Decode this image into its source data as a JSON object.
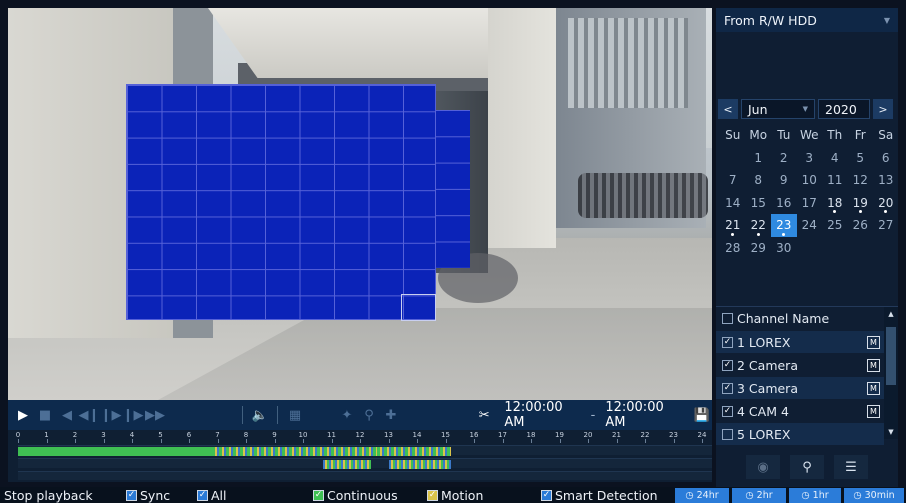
{
  "source": {
    "selected": "From R/W HDD"
  },
  "calendar": {
    "prev": "<",
    "next": ">",
    "month": "Jun",
    "year": "2020",
    "weekdays": [
      "Su",
      "Mo",
      "Tu",
      "We",
      "Th",
      "Fr",
      "Sa"
    ],
    "weeks": [
      [
        "",
        "1",
        "2",
        "3",
        "4",
        "5",
        "6"
      ],
      [
        "7",
        "8",
        "9",
        "10",
        "11",
        "12",
        "13"
      ],
      [
        "14",
        "15",
        "16",
        "17",
        "18",
        "19",
        "20"
      ],
      [
        "21",
        "22",
        "23",
        "24",
        "25",
        "26",
        "27"
      ],
      [
        "28",
        "29",
        "30",
        "",
        "",
        "",
        ""
      ]
    ],
    "recorded_days": [
      "18",
      "19",
      "20",
      "21",
      "22",
      "23"
    ],
    "selected_day": "23"
  },
  "channels": {
    "header": "Channel Name",
    "items": [
      {
        "label": "1 LOREX",
        "checked": true,
        "badge": "M"
      },
      {
        "label": "2 Camera",
        "checked": true,
        "badge": "M"
      },
      {
        "label": "3 Camera",
        "checked": true,
        "badge": "M"
      },
      {
        "label": "4 CAM 4",
        "checked": true,
        "badge": "M"
      },
      {
        "label": "5 LOREX",
        "checked": false,
        "badge": ""
      }
    ]
  },
  "clip": {
    "start": "12:00:00 AM",
    "separator": "-",
    "end": "12:00:00 AM"
  },
  "timeline": {
    "hours": [
      "0",
      "1",
      "2",
      "3",
      "4",
      "5",
      "6",
      "7",
      "8",
      "9",
      "10",
      "11",
      "12",
      "13",
      "14",
      "15",
      "16",
      "17",
      "18",
      "19",
      "20",
      "21",
      "22",
      "23",
      "24"
    ],
    "track1": [
      {
        "start": 0,
        "end": 6.8,
        "kind": "green"
      },
      {
        "start": 6.8,
        "end": 12.6,
        "kind": "mixed"
      },
      {
        "start": 12.6,
        "end": 15.2,
        "kind": "mixed"
      }
    ],
    "track2": [
      {
        "start": 10.7,
        "end": 12.4,
        "kind": "blue"
      },
      {
        "start": 13.0,
        "end": 15.2,
        "kind": "blue"
      }
    ]
  },
  "status": {
    "stop_label": "Stop playback",
    "sync_label": "Sync",
    "all_label": "All",
    "continuous_label": "Continuous",
    "motion_label": "Motion",
    "smart_label": "Smart Detection",
    "zoom": [
      "24hr",
      "2hr",
      "1hr",
      "30min"
    ]
  },
  "colors": {
    "continuous": "#3fbf53",
    "motion": "#d9c34a",
    "smart": "#3a79c9",
    "motion_grid": "#0b23b8",
    "selected_day": "#2f8ae0"
  }
}
